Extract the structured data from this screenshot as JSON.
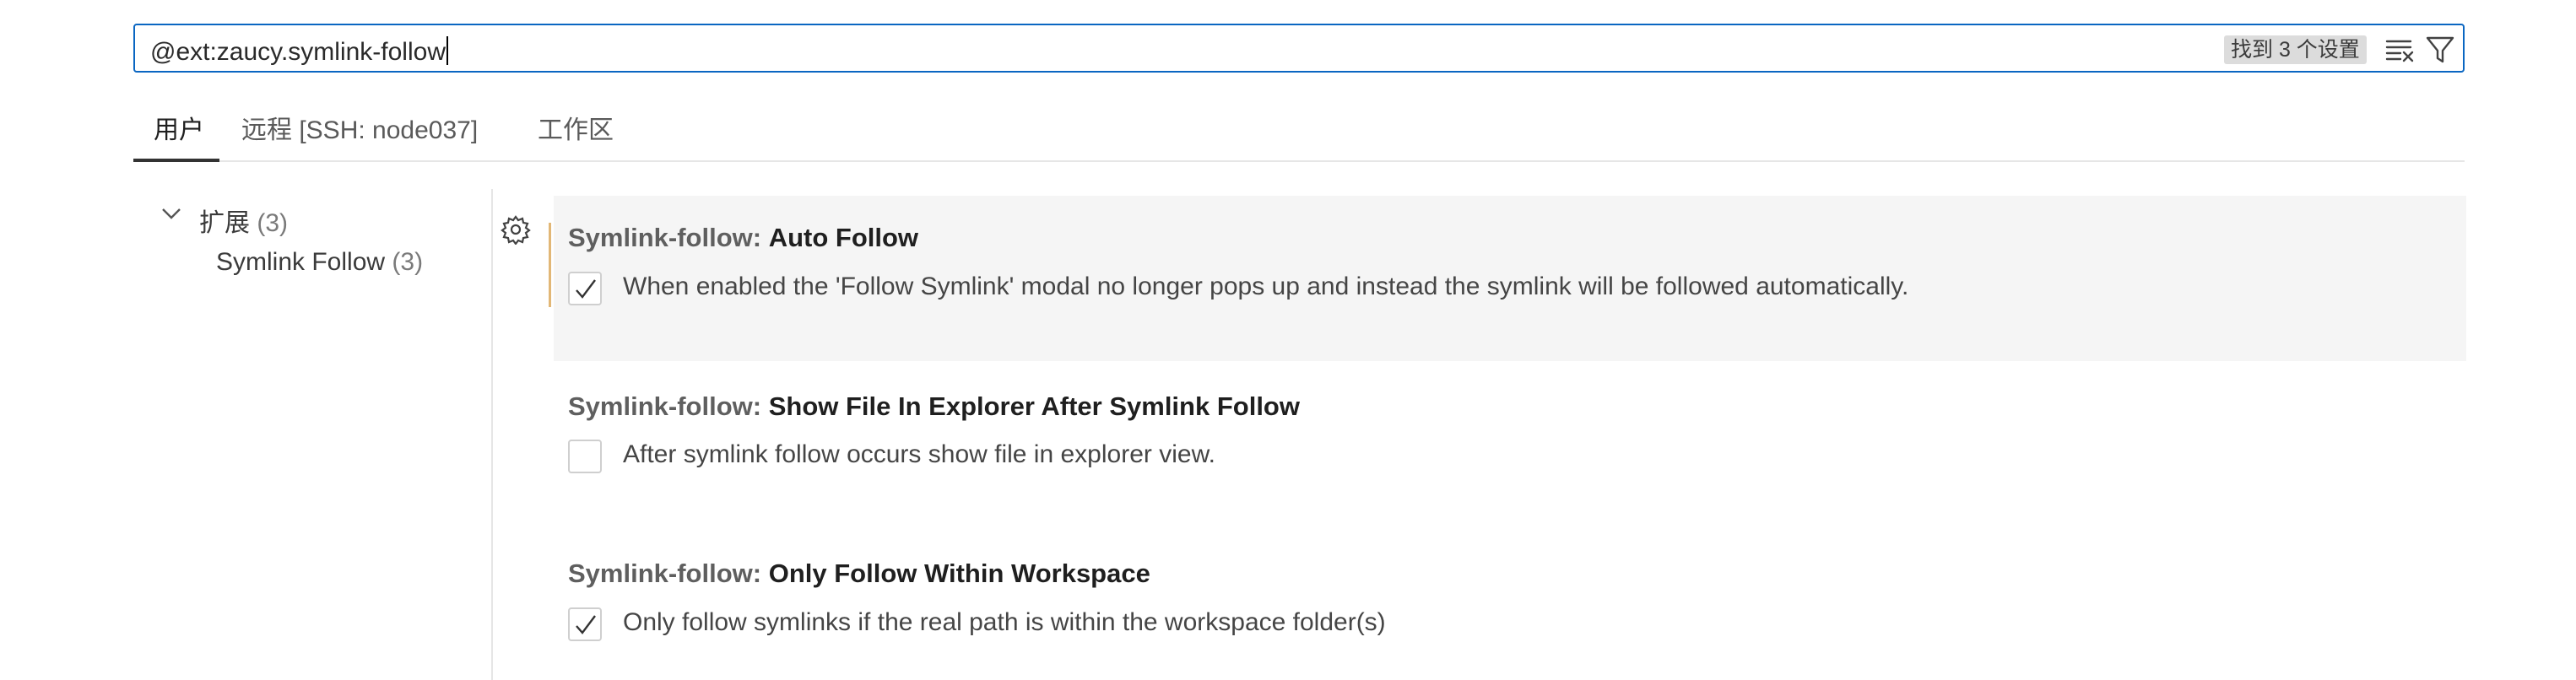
{
  "search": {
    "value": "@ext:zaucy.symlink-follow",
    "result_count": "找到 3 个设置"
  },
  "tabs": [
    {
      "label": "用户",
      "active": true
    },
    {
      "label": "远程 [SSH: node037]",
      "active": false
    },
    {
      "label": "工作区",
      "active": false
    }
  ],
  "tree": {
    "group_label": "扩展",
    "group_count": "(3)",
    "item_label": "Symlink Follow",
    "item_count": "(3)"
  },
  "settings": [
    {
      "category": "Symlink-follow:",
      "name": "Auto Follow",
      "description": "When enabled the 'Follow Symlink' modal no longer pops up and instead the symlink will be followed automatically.",
      "checked": true
    },
    {
      "category": "Symlink-follow:",
      "name": "Show File In Explorer After Symlink Follow",
      "description": "After symlink follow occurs show file in explorer view.",
      "checked": false
    },
    {
      "category": "Symlink-follow:",
      "name": "Only Follow Within Workspace",
      "description": "Only follow symlinks if the real path is within the workspace folder(s)",
      "checked": true
    }
  ],
  "colors": {
    "focus_border": "#0a66c2",
    "modified_indicator": "#e2b776",
    "focused_row_bg": "#f5f5f5"
  },
  "icons": {
    "clear_filter": "clear-all-icon",
    "filter": "filter-icon",
    "tree_toggle": "chevron-down-icon",
    "setting_menu": "gear-icon",
    "check": "check-icon"
  }
}
